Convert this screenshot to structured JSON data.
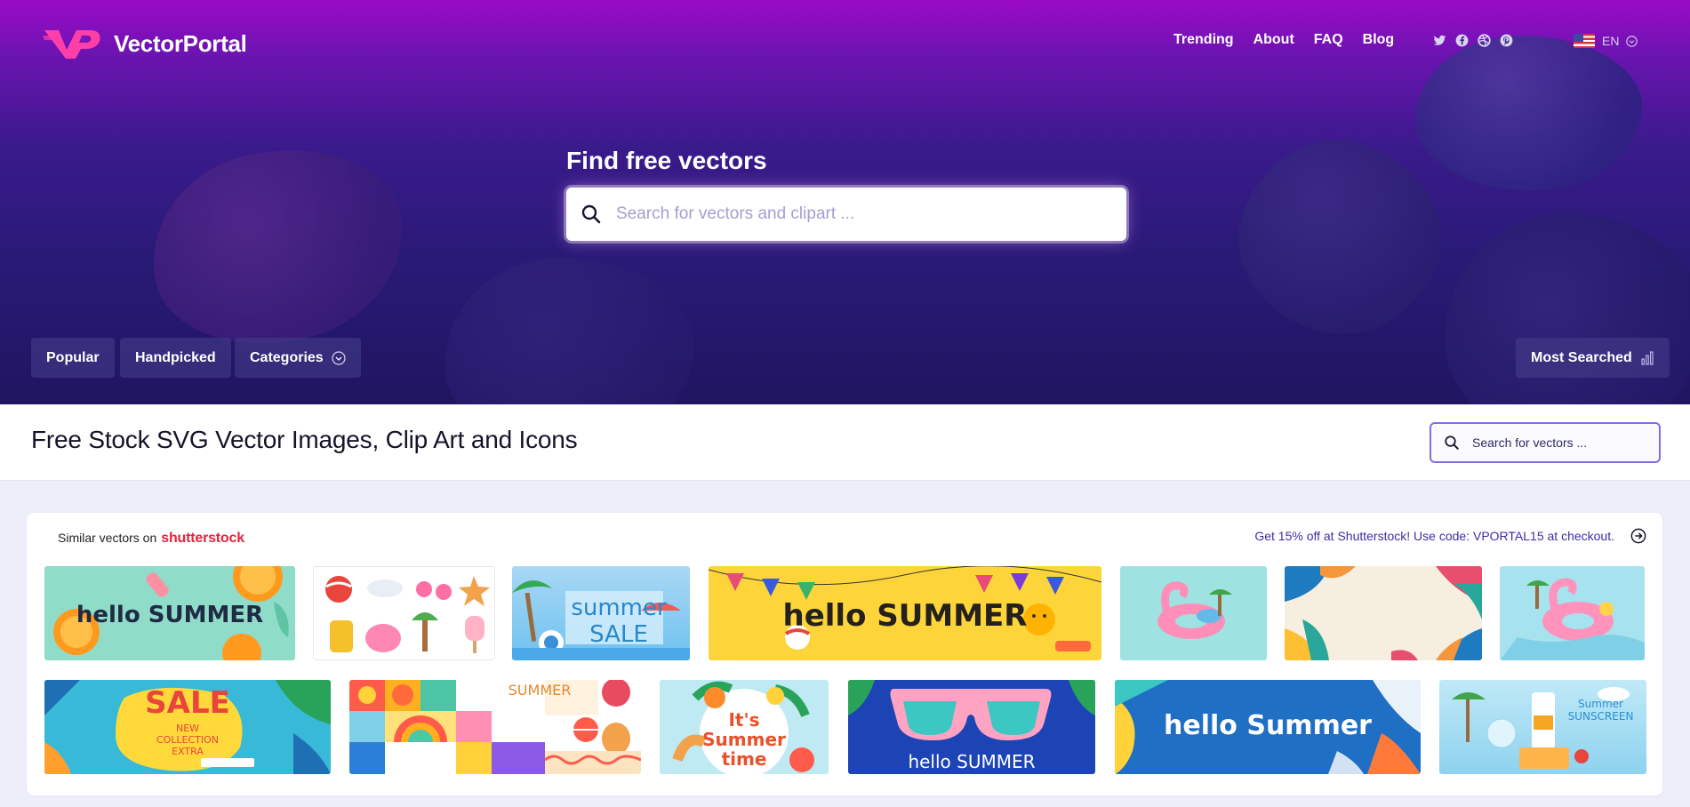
{
  "brand": {
    "name": "VectorPortal",
    "accent": "#ff3fa8"
  },
  "nav": {
    "links": [
      "Trending",
      "About",
      "FAQ",
      "Blog"
    ],
    "social_icons": [
      "twitter-icon",
      "facebook-icon",
      "dribbble-icon",
      "pinterest-icon"
    ],
    "language": "EN"
  },
  "hero": {
    "title": "Find free vectors",
    "search_placeholder": "Search for vectors and clipart ...",
    "pills": {
      "popular": "Popular",
      "handpicked": "Handpicked",
      "categories": "Categories",
      "most_searched": "Most Searched"
    }
  },
  "page": {
    "title": "Free Stock SVG Vector Images, Clip Art and Icons",
    "search_placeholder": "Search for vectors ..."
  },
  "similar": {
    "label": "Similar vectors on",
    "provider": "shutterstock",
    "promo": "Get 15% off at Shutterstock! Use code: VPORTAL15 at checkout."
  },
  "thumbnails": {
    "row1": [
      {
        "name": "hello-summer-oranges",
        "text": "hello SUMMER"
      },
      {
        "name": "summer-3d-objects",
        "text": ""
      },
      {
        "name": "summer-sale-pool",
        "text": "summer SALE"
      },
      {
        "name": "hello-summer-flags",
        "text": "hello SUMMER"
      },
      {
        "name": "flamingo-float",
        "text": ""
      },
      {
        "name": "tropical-leaves-frame",
        "text": ""
      },
      {
        "name": "flamingo-float-2",
        "text": ""
      }
    ],
    "row2": [
      {
        "name": "sale-new-collection",
        "text": "SALE",
        "subtext": "NEW COLLECTION EXTRA"
      },
      {
        "name": "summer-pattern-grid",
        "text": "SUMMER"
      },
      {
        "name": "its-summer-time",
        "text": "It's Summer time"
      },
      {
        "name": "hello-summer-sunglasses",
        "text": "hello SUMMER"
      },
      {
        "name": "hello-summer-blue",
        "text": "hello Summer"
      },
      {
        "name": "summer-sunscreen",
        "text": "Summer SUNSCREEN"
      }
    ]
  }
}
